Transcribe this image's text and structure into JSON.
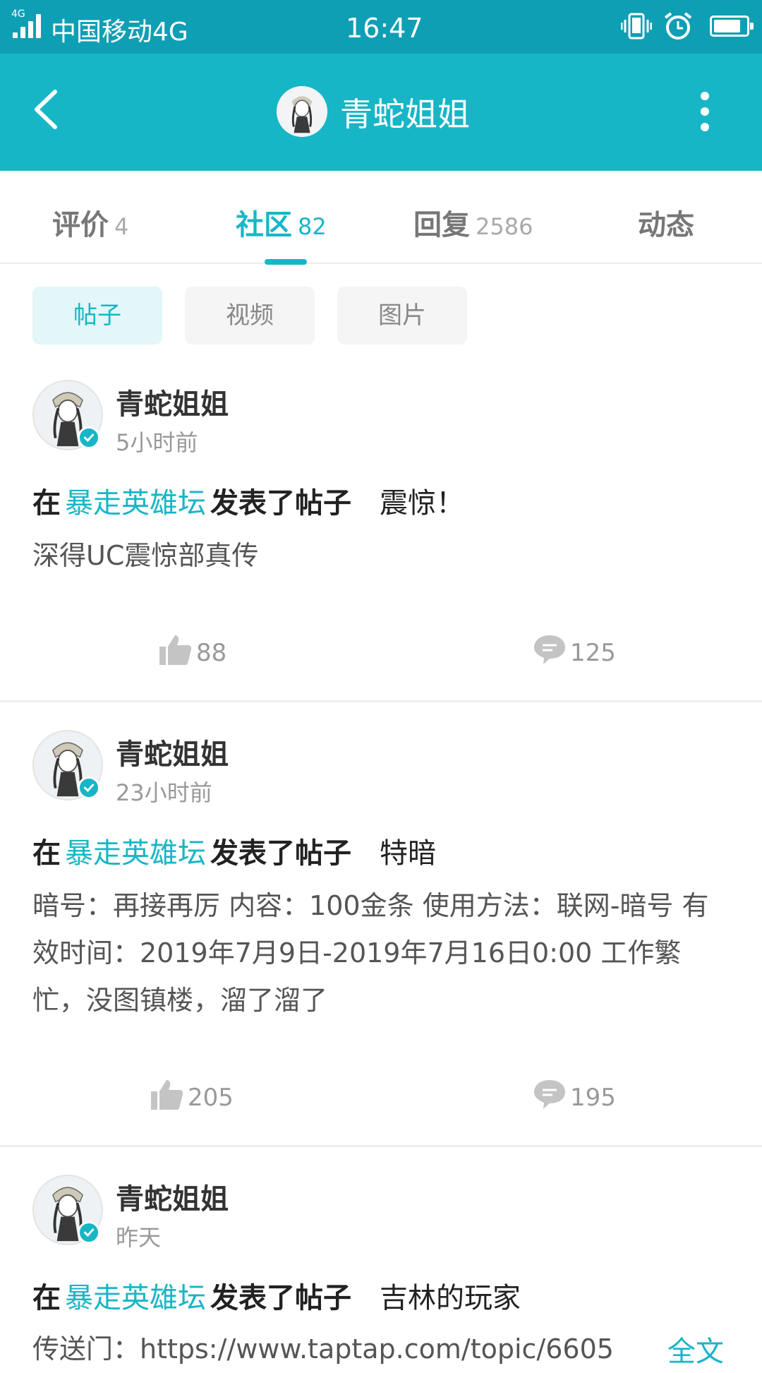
{
  "status_bar": {
    "network_type": "4G",
    "carrier": "中国移动4G",
    "time": "16:47",
    "battery_level": 0.85
  },
  "header": {
    "title": "青蛇姐姐"
  },
  "tabs": [
    {
      "label": "评价",
      "count": "4",
      "active": false
    },
    {
      "label": "社区",
      "count": "82",
      "active": true
    },
    {
      "label": "回复",
      "count": "2586",
      "active": false
    },
    {
      "label": "动态",
      "count": "",
      "active": false
    }
  ],
  "filters": [
    {
      "label": "帖子",
      "active": true
    },
    {
      "label": "视频",
      "active": false
    },
    {
      "label": "图片",
      "active": false
    }
  ],
  "posts": [
    {
      "author": "青蛇姐姐",
      "time": "5小时前",
      "prefix": "在",
      "forum": "暴走英雄坛",
      "action": "发表了帖子",
      "title": "震惊！",
      "body": "深得UC震惊部真传",
      "likes": "88",
      "comments": "125"
    },
    {
      "author": "青蛇姐姐",
      "time": "23小时前",
      "prefix": "在",
      "forum": "暴走英雄坛",
      "action": "发表了帖子",
      "title": "特暗",
      "body": "暗号：再接再厉 内容：100金条 使用方法：联网-暗号 有效时间：2019年7月9日-2019年7月16日0:00 工作繁忙，没图镇楼，溜了溜了",
      "likes": "205",
      "comments": "195"
    },
    {
      "author": "青蛇姐姐",
      "time": "昨天",
      "prefix": "在",
      "forum": "暴走英雄坛",
      "action": "发表了帖子",
      "title": "吉林的玩家",
      "body": "传送门：https://www.taptap.com/topic/6605",
      "read_more": "全文"
    }
  ],
  "colors": {
    "accent": "#17b6c6",
    "status_bar": "#0f9fb4"
  },
  "icons": {
    "back": "chevron-left-icon",
    "more": "more-vertical-icon",
    "like": "thumbs-up-icon",
    "comment": "comment-bubble-icon",
    "verified": "verified-check-icon"
  }
}
